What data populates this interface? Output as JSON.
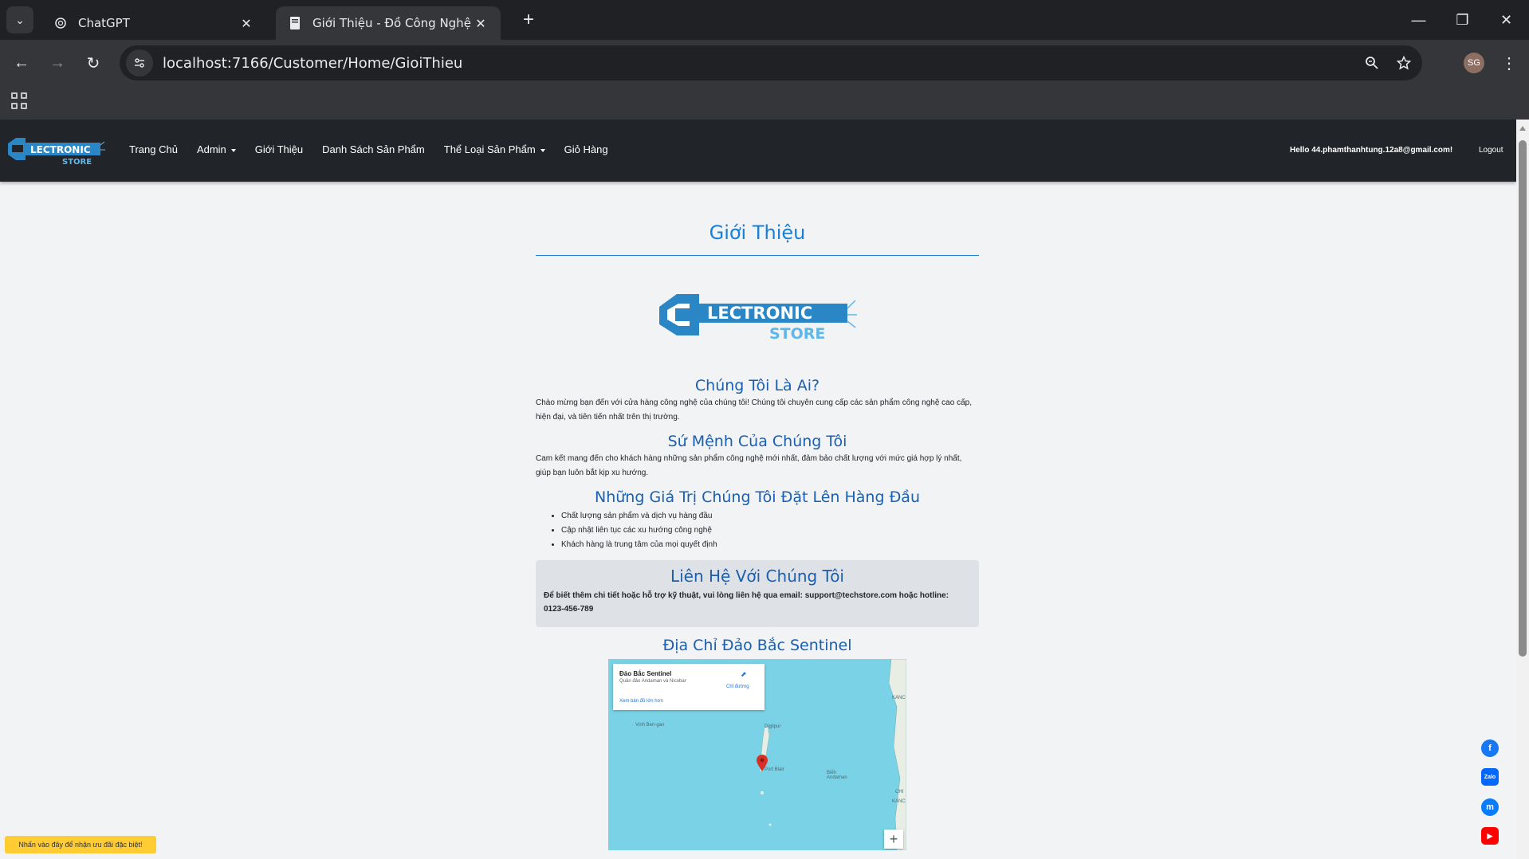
{
  "browser": {
    "tabs": [
      {
        "title": "ChatGPT",
        "active": false,
        "icon": "chatgpt-icon"
      },
      {
        "title": "Giới Thiệu - Đồ Công Nghệ - Pr",
        "active": true,
        "icon": "document-icon"
      }
    ],
    "url": "localhost:7166/Customer/Home/GioiThieu",
    "profile_initials": "SG"
  },
  "site": {
    "brand": {
      "line1": "LECTRONIC",
      "line2": "STORE"
    },
    "menu": [
      {
        "label": "Trang Chủ",
        "dropdown": false
      },
      {
        "label": "Admin",
        "dropdown": true
      },
      {
        "label": "Giới Thiệu",
        "dropdown": false
      },
      {
        "label": "Danh Sách Sản Phẩm",
        "dropdown": false
      },
      {
        "label": "Thể Loại Sản Phẩm",
        "dropdown": true
      },
      {
        "label": "Giỏ Hàng",
        "dropdown": false
      }
    ],
    "hello": "Hello 44.phamthanhtung.12a8@gmail.com!",
    "logout": "Logout"
  },
  "page": {
    "title": "Giới Thiệu",
    "who": {
      "heading": "Chúng Tôi Là Ai?",
      "text": "Chào mừng bạn đến với cửa hàng công nghệ của chúng tôi! Chúng tôi chuyên cung cấp các sản phẩm công nghệ cao cấp, hiện đại, và tiên tiến nhất trên thị trường."
    },
    "mission": {
      "heading": "Sứ Mệnh Của Chúng Tôi",
      "text": "Cam kết mang đến cho khách hàng những sản phẩm công nghệ mới nhất, đảm bảo chất lượng với mức giá hợp lý nhất, giúp bạn luôn bắt kịp xu hướng."
    },
    "values": {
      "heading": "Những Giá Trị Chúng Tôi Đặt Lên Hàng Đầu",
      "items": [
        "Chất lượng sản phẩm và dịch vụ hàng đầu",
        "Cập nhật liên tục các xu hướng công nghệ",
        "Khách hàng là trung tâm của mọi quyết định"
      ]
    },
    "contact": {
      "heading": "Liên Hệ Với Chúng Tôi",
      "text": "Để biết thêm chi tiết hoặc hỗ trợ kỹ thuật, vui lòng liên hệ qua email: support@techstore.com hoặc hotline: 0123-456-789"
    },
    "address": {
      "heading": "Địa Chỉ Đảo Bắc Sentinel"
    },
    "map": {
      "place": "Đảo Bắc Sentinel",
      "region": "Quần đảo Andaman và Nicobar",
      "directions": "Chỉ đường",
      "larger_map": "Xem bản đồ lớn hơn",
      "labels": [
        "Vịnh Ben-gan",
        "Diglipur",
        "Port Blair",
        "Biển Andaman",
        "KANC",
        "CHI",
        "KANC"
      ],
      "zoom_in": "+"
    },
    "promo": "Nhấn vào đây để nhận ưu đãi đặc biệt!"
  },
  "colors": {
    "accent": "#1a7fd6",
    "nav_bg": "#212529",
    "page_bg": "#f1f3f5",
    "contact_bg": "#dee2e6",
    "promo_bg": "#ffcc33",
    "facebook": "#1877f2",
    "zalo": "#0068ff",
    "messenger": "#0a7cff",
    "youtube": "#ff0000"
  },
  "social": [
    {
      "name": "facebook",
      "glyph": "f"
    },
    {
      "name": "zalo",
      "glyph": "Zalo"
    },
    {
      "name": "messenger",
      "glyph": "m"
    },
    {
      "name": "youtube",
      "glyph": "▶"
    }
  ]
}
